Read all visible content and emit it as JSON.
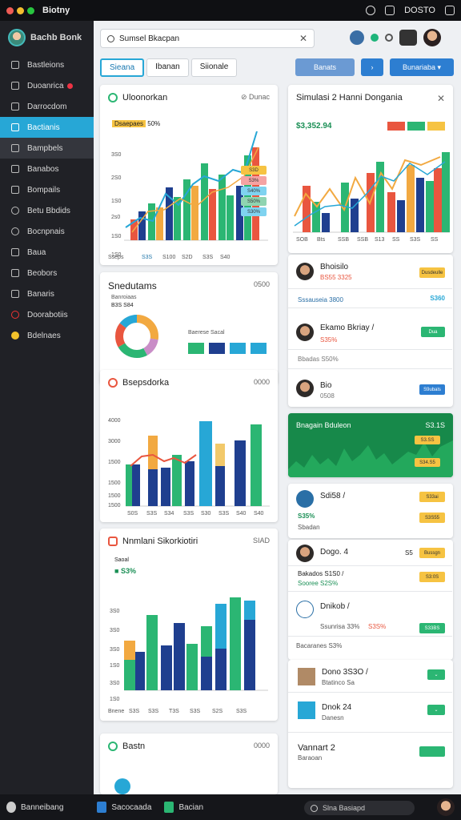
{
  "window": {
    "title": "Biotny",
    "right_label": "DOSTO"
  },
  "sidebar": {
    "brand": "Bachb Bonk",
    "items": [
      {
        "label": "Bastleions"
      },
      {
        "label": "Duoanrica"
      },
      {
        "label": "Darrocdom"
      },
      {
        "label": "Bactianis"
      },
      {
        "label": "Bampbels"
      },
      {
        "label": "Banabos"
      },
      {
        "label": "Bompails"
      },
      {
        "label": "Betu Bbdids"
      },
      {
        "label": "Bocnpnais"
      },
      {
        "label": "Baua"
      },
      {
        "label": "Beobors"
      },
      {
        "label": "Banaris"
      },
      {
        "label": "Doorabotiis"
      },
      {
        "label": "Bdelnaes"
      }
    ]
  },
  "search": {
    "value": "Sumsel Bkacpan"
  },
  "tabs": [
    "Sieana",
    "Ibanan",
    "Siionale"
  ],
  "buttons": {
    "b1": "Banats",
    "b2": "Bunariaba"
  },
  "cards": {
    "c1": {
      "title": "Uloonorkan",
      "meta": "Dunac",
      "label": "Dsaepaes",
      "pct": "50%",
      "ticks": [
        "Sseps",
        "S3S",
        "S100",
        "S2D",
        "S3S",
        "S40"
      ],
      "y": [
        "3S0",
        "2S0",
        "1S0",
        "2s0",
        "1S0",
        "1S0"
      ],
      "tags": [
        "S3D",
        "S3%",
        "S40%",
        "S50%",
        "S30%"
      ]
    },
    "c2": {
      "title": "Snedutams",
      "meta": "0500",
      "label": "Banroiaas",
      "value": "B3S S84",
      "legend": "Baerese Sacal"
    },
    "c3": {
      "title": "Bsepsdorka",
      "meta": "0000",
      "y": [
        "4000",
        "3000",
        "1500",
        "1500",
        "1500",
        "1500"
      ],
      "x": [
        "S0S",
        "S3S",
        "S34",
        "S3S",
        "S30",
        "S3S",
        "S40",
        "S40"
      ]
    },
    "c4": {
      "title": "Nnmlani Sikorkiotiri",
      "meta": "SIAD",
      "pct": "S3%",
      "label": "Saoal",
      "y": [
        "3S0",
        "3S0",
        "3S0",
        "1S0",
        "3S0",
        "1S0"
      ],
      "x": [
        "Bnene",
        "S3S",
        "S3S",
        "T3S",
        "S3S",
        "S2S",
        "S3S"
      ]
    },
    "c5": {
      "title": "Bastn",
      "meta": "0000"
    },
    "r1": {
      "title": "Simulasi 2 Hanni Dongania",
      "value": "$3,352.94",
      "ticks": [
        "SOB",
        "Bts",
        "SSB",
        "SSB",
        "S13",
        "SS",
        "S3S",
        "SS"
      ]
    },
    "r2": {
      "name": "Bhoisilo",
      "sub": "BS55 3325",
      "caption": "Sssauseia 3800",
      "tag": "S360",
      "btn": "Dusdeulle"
    },
    "r3": {
      "name": "Ekamo Bkriay /",
      "pct": "S35%",
      "caption": "Bbadas S50%",
      "btn": "Dua"
    },
    "r4": {
      "name": "Bio",
      "sub": "0508",
      "btn": "S9ubals"
    },
    "r5": {
      "title": "Bnagain Bduleon",
      "t1": "S3.1S",
      "t2": "S3.SS",
      "t3": "S34.S5"
    },
    "r6": {
      "name": "Sdi58 /",
      "pct": "S35%",
      "tag": "Sbadan",
      "btn": "S33ai",
      "t2": "S3S55"
    },
    "r7": {
      "name": "Dogo. 4",
      "a": "Bakados S1S0 /",
      "b": "Sooree S2S%",
      "c": "S5",
      "btn": "Bussgn",
      "btn2": "S3:0S"
    },
    "r8": {
      "name": "Dnikob /",
      "pct": "S3S%",
      "sub": "Ssunrisa 33%",
      "btn": "S33BS",
      "caption": "Bacaranes S3%"
    },
    "r9": {
      "name": "Dono 3S3O /",
      "sub": "Btatinco Sa"
    },
    "r10": {
      "name": "Dnok 24",
      "sub": "Danesn"
    },
    "r11": {
      "name": "Vannart 2",
      "sub": "Baraoan"
    }
  },
  "bottom": {
    "a": "Banneibang",
    "b": "Sacocaada",
    "c": "Bacian",
    "search": "Slna Basiapd"
  }
}
